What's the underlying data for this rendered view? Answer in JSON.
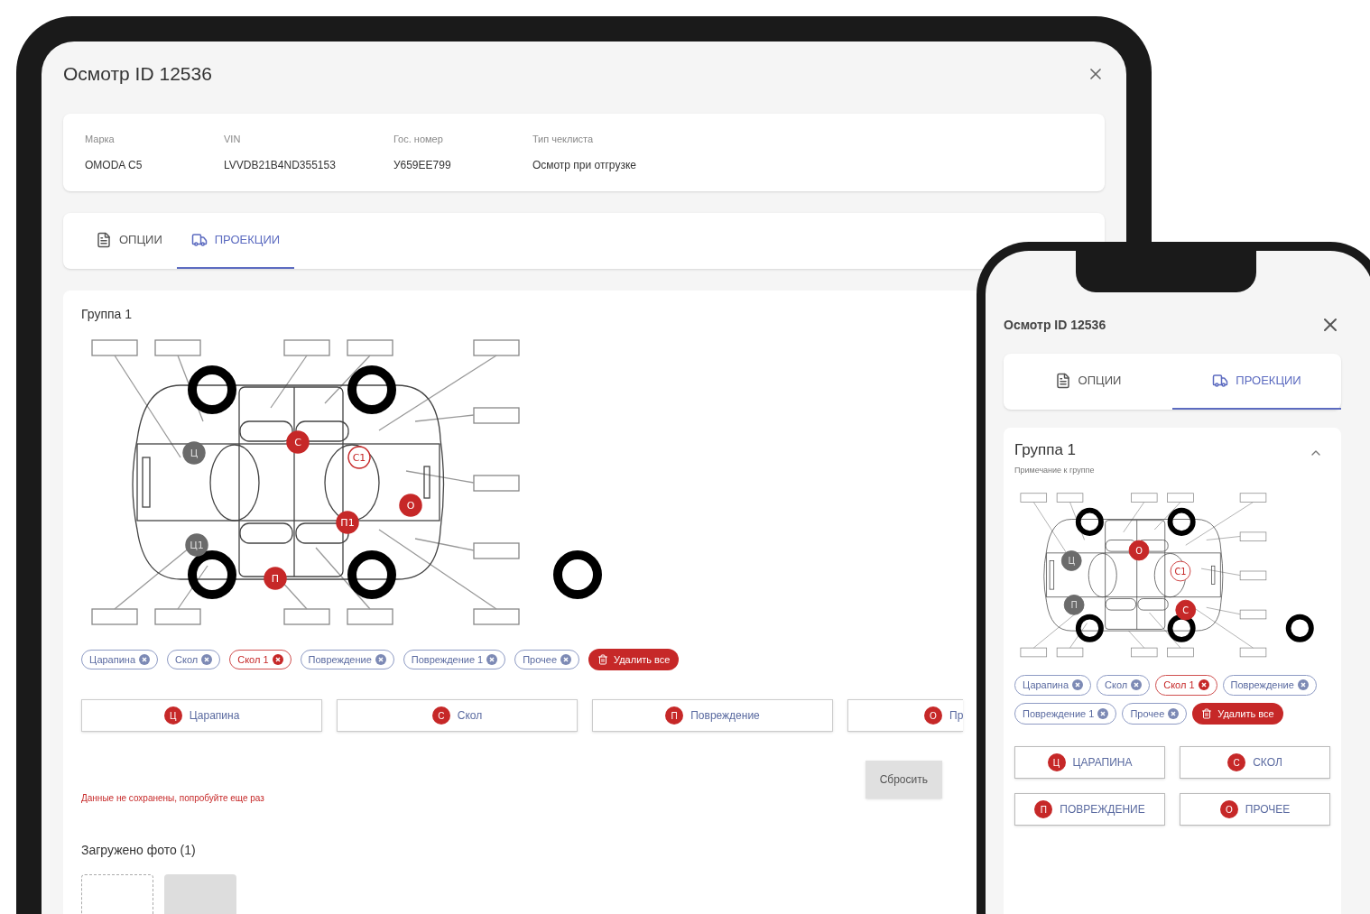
{
  "tablet": {
    "title": "Осмотр ID 12536",
    "info": [
      {
        "label": "Марка",
        "value": "OMODA C5"
      },
      {
        "label": "VIN",
        "value": "LVVDB21B4ND355153"
      },
      {
        "label": "Гос. номер",
        "value": "У659ЕЕ799"
      },
      {
        "label": "Тип чеклиста",
        "value": "Осмотр при отгрузке"
      }
    ],
    "tabs": [
      {
        "label": "ОПЦИИ",
        "selected": false
      },
      {
        "label": "ПРОЕКЦИИ",
        "selected": true
      }
    ],
    "group": {
      "title": "Группа 1",
      "markers": [
        {
          "label": "Ц",
          "kind": "muted"
        },
        {
          "label": "С",
          "kind": "filled"
        },
        {
          "label": "С1",
          "kind": "outlined"
        },
        {
          "label": "О",
          "kind": "filled"
        },
        {
          "label": "П1",
          "kind": "filled"
        },
        {
          "label": "Ц1",
          "kind": "muted"
        },
        {
          "label": "П",
          "kind": "filled"
        }
      ],
      "chips": [
        {
          "label": "Царапина",
          "selected": false
        },
        {
          "label": "Скол",
          "selected": false
        },
        {
          "label": "Скол 1",
          "selected": true
        },
        {
          "label": "Повреждение",
          "selected": false
        },
        {
          "label": "Повреждение 1",
          "selected": false
        },
        {
          "label": "Прочее",
          "selected": false
        }
      ],
      "delete_all": "Удалить все",
      "damage_buttons": [
        {
          "letter": "Ц",
          "label": "Царапина"
        },
        {
          "letter": "С",
          "label": "Скол"
        },
        {
          "letter": "П",
          "label": "Повреждение"
        },
        {
          "letter": "О",
          "label": "Пр"
        }
      ],
      "reset": "Сбросить",
      "error": "Данные не сохранены, попробуйте еще раз",
      "photos_title": "Загружено фото (1)"
    }
  },
  "phone": {
    "title": "Осмотр ID 12536",
    "tabs": [
      {
        "label": "ОПЦИИ",
        "selected": false
      },
      {
        "label": "ПРОЕКЦИИ",
        "selected": true
      }
    ],
    "group": {
      "title": "Группа 1",
      "subtitle": "Примечание к группе",
      "expanded": true,
      "markers": [
        {
          "label": "Ц",
          "kind": "muted"
        },
        {
          "label": "О",
          "kind": "filled"
        },
        {
          "label": "С1",
          "kind": "outlined"
        },
        {
          "label": "С",
          "kind": "filled"
        },
        {
          "label": "П",
          "kind": "muted"
        }
      ],
      "chips": [
        {
          "label": "Царапина",
          "selected": false
        },
        {
          "label": "Скол",
          "selected": false
        },
        {
          "label": "Скол 1",
          "selected": true
        },
        {
          "label": "Повреждение",
          "selected": false
        },
        {
          "label": "Повреждение 1",
          "selected": false
        },
        {
          "label": "Прочее",
          "selected": false
        }
      ],
      "delete_all": "Удалить все",
      "damage_buttons": [
        {
          "letter": "Ц",
          "label": "ЦАРАПИНА"
        },
        {
          "letter": "С",
          "label": "СКОЛ"
        },
        {
          "letter": "П",
          "label": "ПОВРЕЖДЕНИЕ"
        },
        {
          "letter": "О",
          "label": "ПРОЧЕЕ"
        }
      ]
    }
  }
}
